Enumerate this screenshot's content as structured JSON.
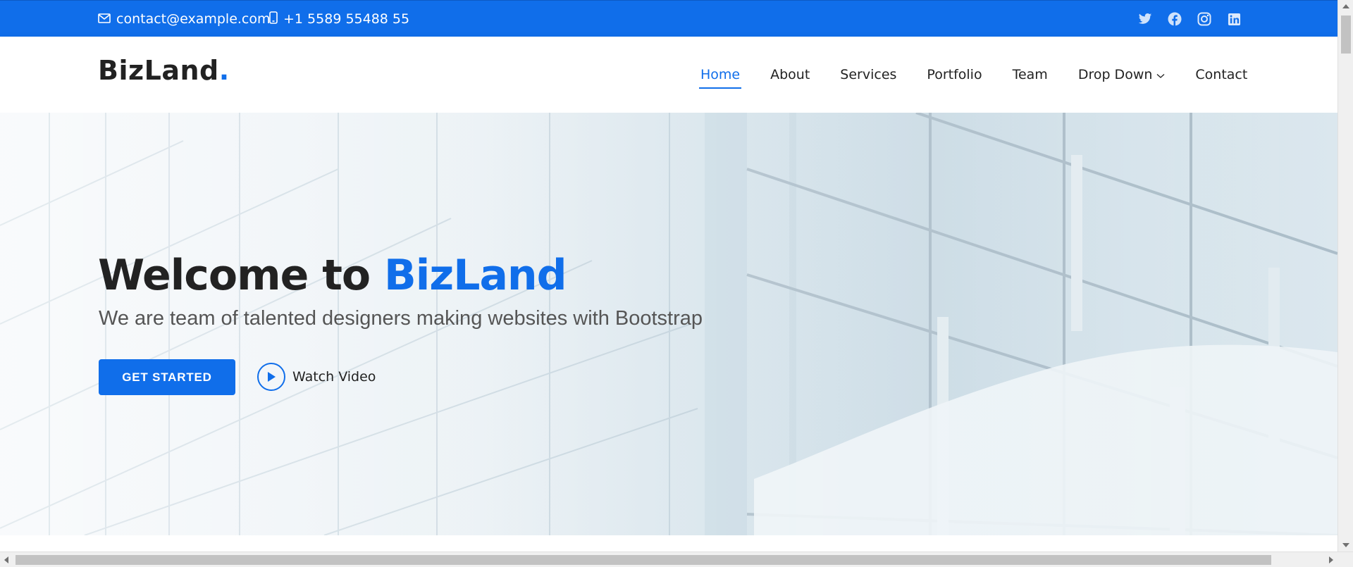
{
  "topbar": {
    "email": "contact@example.com",
    "phone": "+1 5589 55488 55",
    "socials": [
      "twitter-icon",
      "facebook-icon",
      "instagram-icon",
      "linkedin-icon"
    ]
  },
  "header": {
    "logo_text": "BizLand",
    "logo_dot": ".",
    "nav": [
      {
        "label": "Home",
        "active": true
      },
      {
        "label": "About"
      },
      {
        "label": "Services"
      },
      {
        "label": "Portfolio"
      },
      {
        "label": "Team"
      },
      {
        "label": "Drop Down",
        "has_dropdown": true
      },
      {
        "label": "Contact"
      }
    ]
  },
  "hero": {
    "title_prefix": "Welcome to ",
    "title_brand": "BizLand",
    "subtitle": "We are team of talented designers making websites with Bootstrap",
    "cta_label": "GET STARTED",
    "watch_label": "Watch Video"
  },
  "colors": {
    "accent": "#106eea",
    "text_dark": "#222222",
    "text_muted": "#555555"
  }
}
